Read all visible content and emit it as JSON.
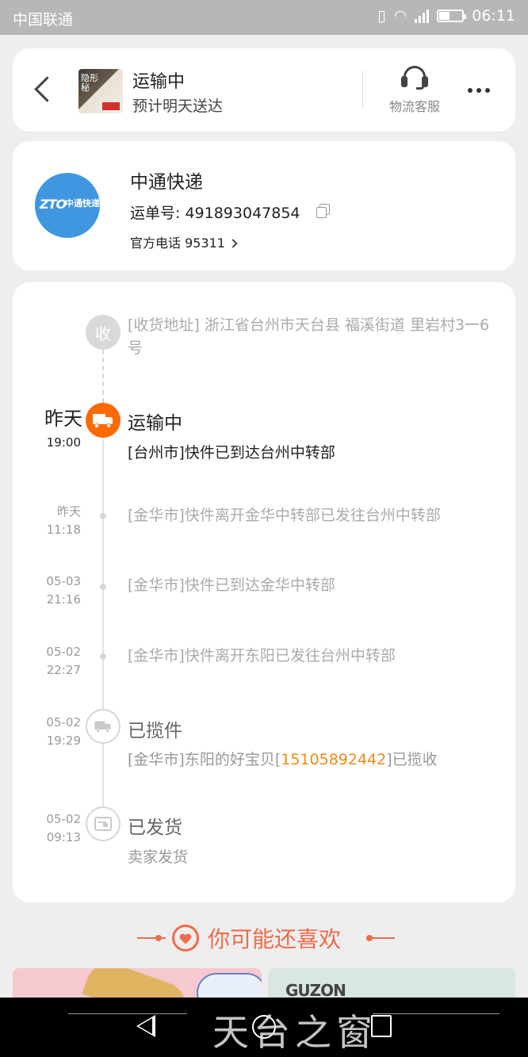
{
  "status_bar": {
    "carrier": "中国联通",
    "time": "06:11",
    "battery_level": 0.45
  },
  "header": {
    "status": "运输中",
    "eta": "预计明天送达",
    "thumb_text": "隐形 秘",
    "customer_service_label": "物流客服"
  },
  "courier": {
    "name": "中通快递",
    "tracking_label": "运单号: ",
    "tracking_number": "491893047854",
    "phone_label": "官方电话 95311",
    "logo_text": "ZTO",
    "logo_cn": "中通快递"
  },
  "timeline": {
    "receiver": {
      "badge": "收",
      "address": "[收货地址] 浙江省台州市天台县 福溪街道   里岩村3一6号"
    },
    "events": [
      {
        "date": "昨天",
        "time": "19:00",
        "status": "运输中",
        "text": "[台州市]快件已到达台州中转部"
      },
      {
        "date": "昨天",
        "time": "11:18",
        "text": "[金华市]快件离开金华中转部已发往台州中转部"
      },
      {
        "date": "05-03",
        "time": "21:16",
        "text": "[金华市]快件已到达金华中转部"
      },
      {
        "date": "05-02",
        "time": "22:27",
        "text": "[金华市]快件离开东阳已发往台州中转部"
      },
      {
        "date": "05-02",
        "time": "19:29",
        "status": "已揽件",
        "text_pre": "[金华市]东阳的好宝贝[",
        "text_phone": "15105892442",
        "text_post": "]已揽收"
      },
      {
        "date": "05-02",
        "time": "09:13",
        "status": "已发货",
        "text": "卖家发货"
      }
    ]
  },
  "recommend": {
    "title": "你可能还喜欢",
    "product2_brand": "GUZON"
  },
  "watermark": "天台之窗",
  "colors": {
    "accent_orange": "#ff6a00",
    "highlight": "#f08a1c",
    "recommend": "#f26b4a",
    "zto_blue": "#4097e0"
  }
}
